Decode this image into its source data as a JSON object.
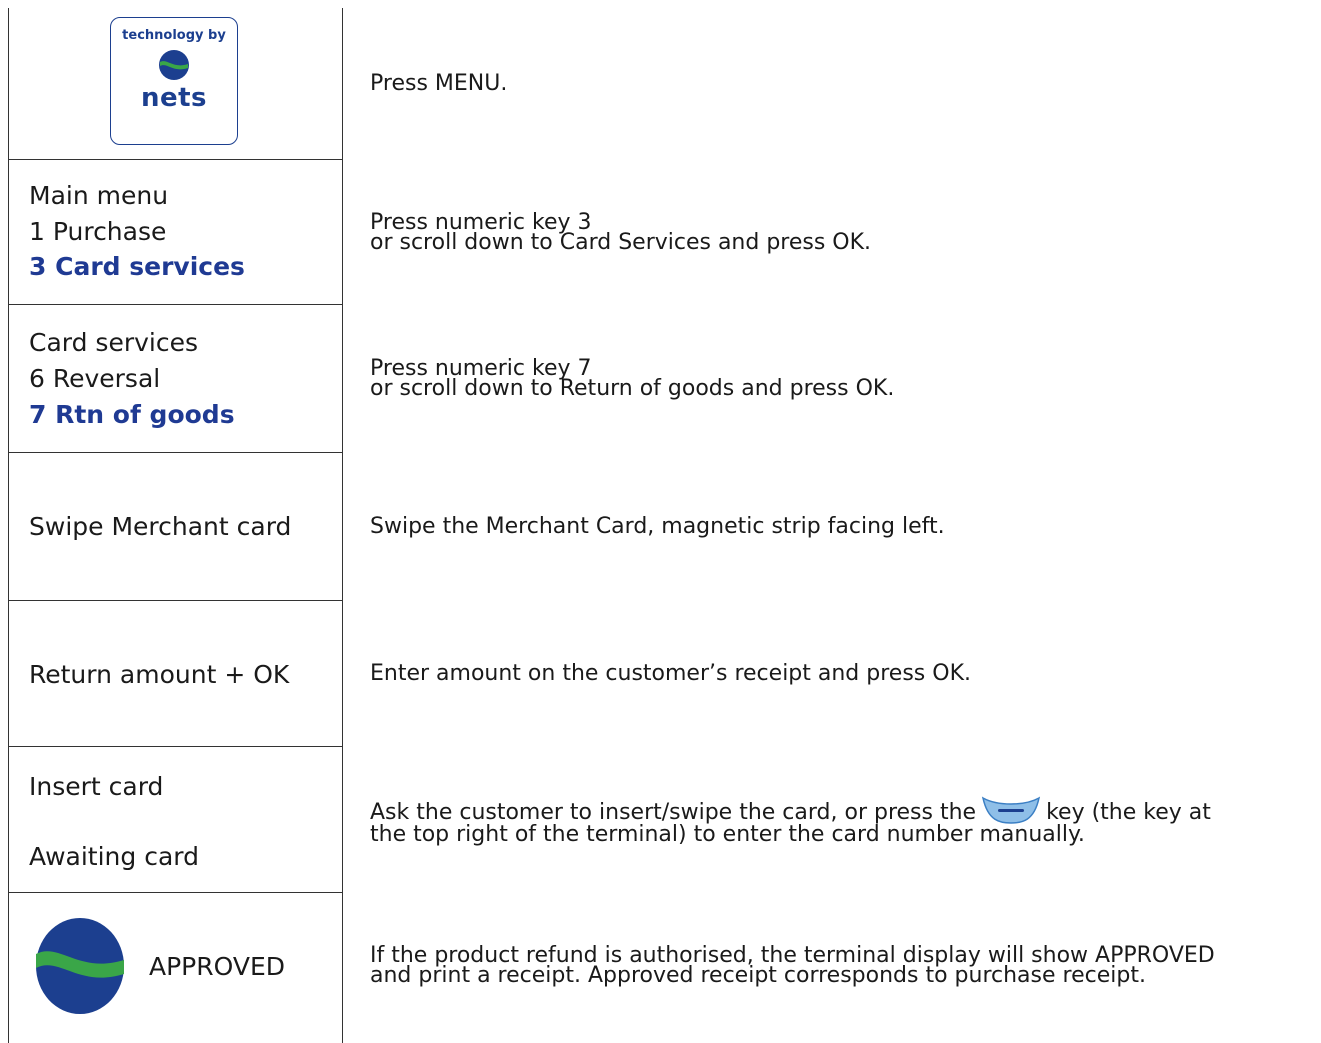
{
  "rows": [
    {
      "logo": {
        "top_text": "technology by",
        "brand": "nets"
      },
      "desc": [
        "Press MENU."
      ]
    },
    {
      "screen": [
        "Main menu",
        "1 Purchase",
        "3 Card services"
      ],
      "desc": [
        "Press numeric key 3",
        "or scroll down to Card Services and press OK."
      ]
    },
    {
      "screen": [
        "Card services",
        "6 Reversal",
        "7 Rtn of goods"
      ],
      "desc": [
        "Press numeric key 7",
        "or scroll down to Return of goods and press OK."
      ]
    },
    {
      "screen": [
        "Swipe Merchant card"
      ],
      "desc": [
        "Swipe the Merchant Card, magnetic strip facing left."
      ]
    },
    {
      "screen": [
        "Return amount + OK"
      ],
      "desc": [
        "Enter amount on the customer’s receipt and press OK."
      ]
    },
    {
      "screen": [
        "Insert card",
        "Awaiting card"
      ],
      "desc_a": "Ask the customer to insert/swipe the card, or press the",
      "desc_b": "key (the key at",
      "desc_c": "the top right of the terminal) to enter the card number manually."
    },
    {
      "screen": [
        "APPROVED"
      ],
      "desc": [
        "If the product refund is authorised, the terminal display will show APPROVED",
        "and print a receipt. Approved receipt corresponds to purchase receipt."
      ]
    }
  ],
  "colors": {
    "accent": "#1f3a93",
    "logo_blue": "#1c3f8f",
    "logo_green": "#3aa648"
  }
}
